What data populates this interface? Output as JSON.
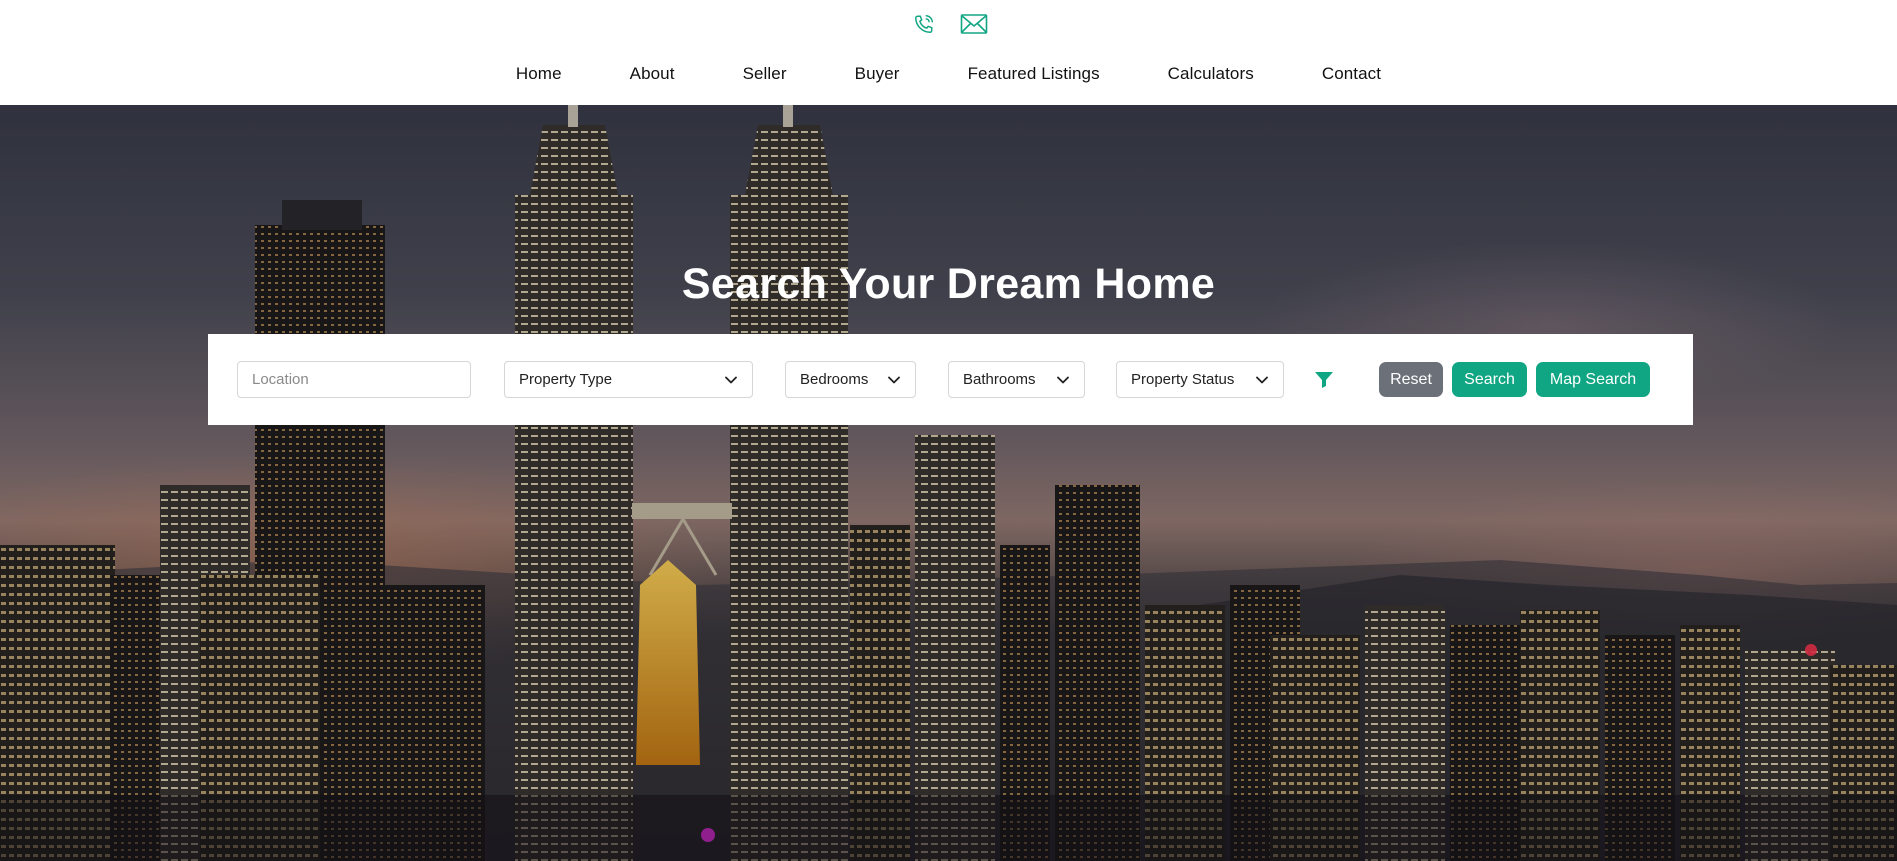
{
  "header": {
    "icons": [
      "phone-icon",
      "envelope-icon"
    ],
    "nav": [
      "Home",
      "About",
      "Seller",
      "Buyer",
      "Featured Listings",
      "Calculators",
      "Contact"
    ]
  },
  "hero": {
    "title": "Search Your Dream Home"
  },
  "search": {
    "location_placeholder": "Location",
    "property_type": "Property Type",
    "bedrooms": "Bedrooms",
    "bathrooms": "Bathrooms",
    "property_status": "Property Status",
    "filter_icon": "filter-icon",
    "reset_label": "Reset",
    "search_label": "Search",
    "map_search_label": "Map Search"
  },
  "colors": {
    "accent": "#11a683",
    "reset_button": "#6c7179"
  }
}
